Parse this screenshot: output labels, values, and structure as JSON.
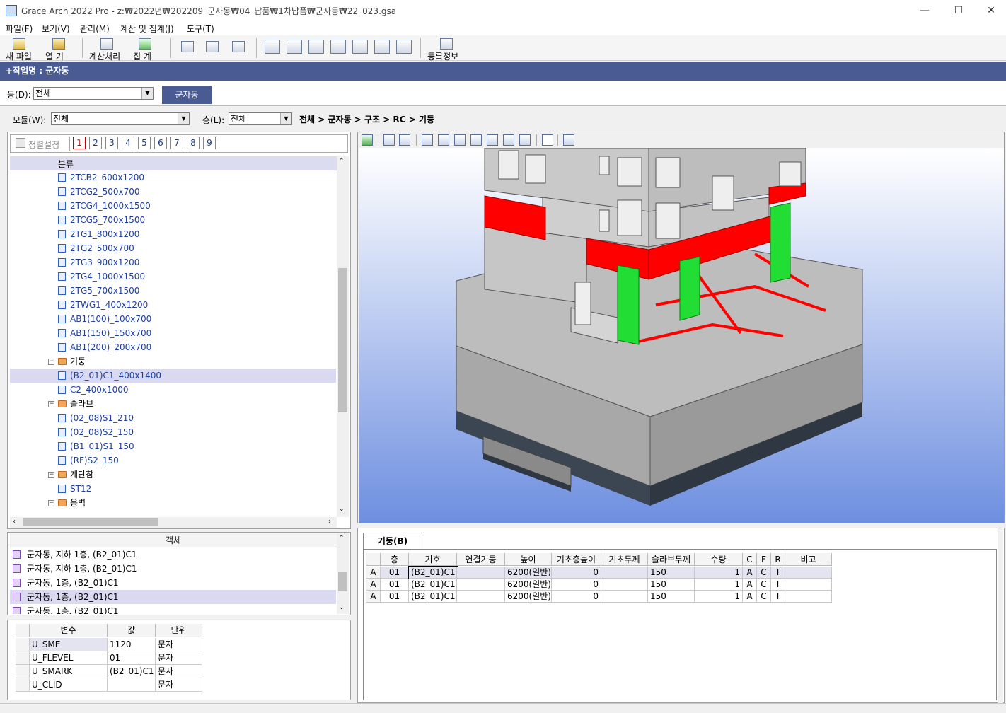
{
  "window": {
    "title": "Grace Arch 2022 Pro - z:₩2022년₩202209_군자동₩04_납품₩1차납품₩군자동₩22_023.gsa",
    "minimize": "—",
    "maximize": "☐",
    "close": "✕"
  },
  "menu": [
    "파일(F)",
    "보기(V)",
    "관리(M)",
    "계산 및 집계(J)",
    "도구(T)"
  ],
  "toolbar": {
    "new_file": "새 파일",
    "open": "열  기",
    "calc": "계산처리",
    "aggregate": "집  계",
    "register": "등록정보"
  },
  "work_header": "+작업명 : 군자동",
  "dong": {
    "label": "동(D):",
    "value": "전체",
    "tab": "군자동"
  },
  "module": {
    "label": "모듈(W):",
    "value": "전체"
  },
  "floor": {
    "label": "층(L):",
    "value": "전체"
  },
  "breadcrumb": "전체 > 군자동 > 구조 > RC > 기둥",
  "sort": {
    "label": "정렬설정",
    "numbers": [
      "1",
      "2",
      "3",
      "4",
      "5",
      "6",
      "7",
      "8",
      "9"
    ]
  },
  "tree": {
    "header": "분류",
    "items": [
      {
        "type": "leaf",
        "text": "2TCB2_600x1200"
      },
      {
        "type": "leaf",
        "text": "2TCG2_500x700"
      },
      {
        "type": "leaf",
        "text": "2TCG4_1000x1500"
      },
      {
        "type": "leaf",
        "text": "2TCG5_700x1500"
      },
      {
        "type": "leaf",
        "text": "2TG1_800x1200"
      },
      {
        "type": "leaf",
        "text": "2TG2_500x700"
      },
      {
        "type": "leaf",
        "text": "2TG3_900x1200"
      },
      {
        "type": "leaf",
        "text": "2TG4_1000x1500"
      },
      {
        "type": "leaf",
        "text": "2TG5_700x1500"
      },
      {
        "type": "leaf",
        "text": "2TWG1_400x1200"
      },
      {
        "type": "leaf",
        "text": "AB1(100)_100x700"
      },
      {
        "type": "leaf",
        "text": "AB1(150)_150x700"
      },
      {
        "type": "leaf",
        "text": "AB1(200)_200x700"
      },
      {
        "type": "folder",
        "text": "기둥"
      },
      {
        "type": "leaf",
        "text": "(B2_01)C1_400x1400",
        "selected": true
      },
      {
        "type": "leaf",
        "text": "C2_400x1000"
      },
      {
        "type": "folder",
        "text": "슬라브"
      },
      {
        "type": "leaf",
        "text": "(02_08)S1_210"
      },
      {
        "type": "leaf",
        "text": "(02_08)S2_150"
      },
      {
        "type": "leaf",
        "text": "(B1_01)S1_150"
      },
      {
        "type": "leaf",
        "text": "(RF)S2_150"
      },
      {
        "type": "folder",
        "text": "계단참"
      },
      {
        "type": "leaf",
        "text": "ST12"
      },
      {
        "type": "folder",
        "text": "옹벽"
      }
    ]
  },
  "objects": {
    "header": "객체",
    "rows": [
      {
        "text": "군자동, 지하 1층, (B2_01)C1"
      },
      {
        "text": "군자동, 지하 1층, (B2_01)C1"
      },
      {
        "text": "군자동, 1층, (B2_01)C1"
      },
      {
        "text": "군자동, 1층, (B2_01)C1",
        "selected": true
      },
      {
        "text": "군자동, 1층, (B2_01)C1"
      }
    ]
  },
  "variables": {
    "headers": [
      "변수",
      "값",
      "단위"
    ],
    "rows": [
      [
        "U_SME",
        "1120",
        "문자"
      ],
      [
        "U_FLEVEL",
        "01",
        "문자"
      ],
      [
        "U_SMARK",
        "(B2_01)C1",
        "문자"
      ],
      [
        "U_CLID",
        "",
        "문자"
      ]
    ]
  },
  "grid": {
    "tab": "기둥(B)",
    "headers": [
      "",
      "층",
      "기호",
      "연결기둥",
      "높이",
      "기초층높이",
      "기초두께",
      "슬라브두께",
      "수량",
      "C",
      "F",
      "R",
      "비고"
    ],
    "rows": [
      [
        "A",
        "01",
        "(B2_01)C1",
        "",
        "6200(일반)",
        "0",
        "",
        "150",
        "1",
        "A",
        "C",
        "T",
        ""
      ],
      [
        "A",
        "01",
        "(B2_01)C1",
        "",
        "6200(일반)",
        "0",
        "",
        "150",
        "1",
        "A",
        "C",
        "T",
        ""
      ],
      [
        "A",
        "01",
        "(B2_01)C1",
        "",
        "6200(일반)",
        "0",
        "",
        "150",
        "1",
        "A",
        "C",
        "T",
        ""
      ]
    ]
  },
  "colors": {
    "header_blue": "#4a5b94",
    "selection": "#d9d9ef",
    "viewport_top": "#ffffff",
    "viewport_bottom": "#6e8fe0",
    "beam_red": "#ff0000",
    "column_green": "#22dd33"
  }
}
